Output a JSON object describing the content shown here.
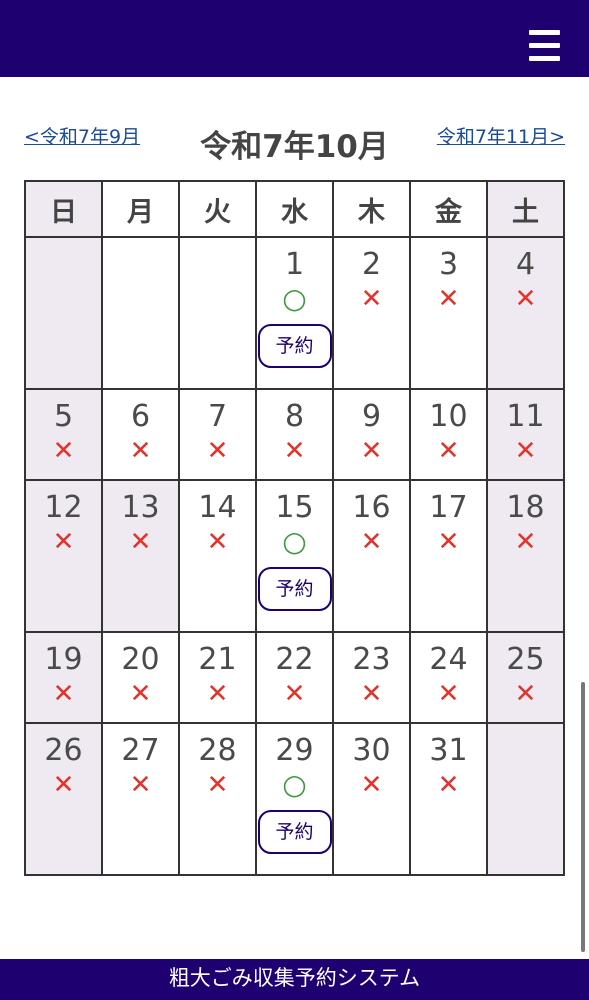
{
  "header": {
    "menu_icon": "hamburger-menu-icon",
    "color": "#1e0070"
  },
  "nav": {
    "prev_label": "<令和7年9月",
    "title": "令和7年10月",
    "next_label": "令和7年11月>"
  },
  "weekdays": [
    "日",
    "月",
    "火",
    "水",
    "木",
    "金",
    "土"
  ],
  "calendar": {
    "rows": [
      [
        {
          "day": "",
          "mark": "",
          "reserve": false,
          "holiday": true
        },
        {
          "day": "",
          "mark": "",
          "reserve": false,
          "holiday": false
        },
        {
          "day": "",
          "mark": "",
          "reserve": false,
          "holiday": false
        },
        {
          "day": "1",
          "mark": "○",
          "reserve": true,
          "holiday": false
        },
        {
          "day": "2",
          "mark": "✕",
          "reserve": false,
          "holiday": false
        },
        {
          "day": "3",
          "mark": "✕",
          "reserve": false,
          "holiday": false
        },
        {
          "day": "4",
          "mark": "✕",
          "reserve": false,
          "holiday": true
        }
      ],
      [
        {
          "day": "5",
          "mark": "✕",
          "reserve": false,
          "holiday": true
        },
        {
          "day": "6",
          "mark": "✕",
          "reserve": false,
          "holiday": false
        },
        {
          "day": "7",
          "mark": "✕",
          "reserve": false,
          "holiday": false
        },
        {
          "day": "8",
          "mark": "✕",
          "reserve": false,
          "holiday": false
        },
        {
          "day": "9",
          "mark": "✕",
          "reserve": false,
          "holiday": false
        },
        {
          "day": "10",
          "mark": "✕",
          "reserve": false,
          "holiday": false
        },
        {
          "day": "11",
          "mark": "✕",
          "reserve": false,
          "holiday": true
        }
      ],
      [
        {
          "day": "12",
          "mark": "✕",
          "reserve": false,
          "holiday": true
        },
        {
          "day": "13",
          "mark": "✕",
          "reserve": false,
          "holiday": true
        },
        {
          "day": "14",
          "mark": "✕",
          "reserve": false,
          "holiday": false
        },
        {
          "day": "15",
          "mark": "○",
          "reserve": true,
          "holiday": false
        },
        {
          "day": "16",
          "mark": "✕",
          "reserve": false,
          "holiday": false
        },
        {
          "day": "17",
          "mark": "✕",
          "reserve": false,
          "holiday": false
        },
        {
          "day": "18",
          "mark": "✕",
          "reserve": false,
          "holiday": true
        }
      ],
      [
        {
          "day": "19",
          "mark": "✕",
          "reserve": false,
          "holiday": true
        },
        {
          "day": "20",
          "mark": "✕",
          "reserve": false,
          "holiday": false
        },
        {
          "day": "21",
          "mark": "✕",
          "reserve": false,
          "holiday": false
        },
        {
          "day": "22",
          "mark": "✕",
          "reserve": false,
          "holiday": false
        },
        {
          "day": "23",
          "mark": "✕",
          "reserve": false,
          "holiday": false
        },
        {
          "day": "24",
          "mark": "✕",
          "reserve": false,
          "holiday": false
        },
        {
          "day": "25",
          "mark": "✕",
          "reserve": false,
          "holiday": true
        }
      ],
      [
        {
          "day": "26",
          "mark": "✕",
          "reserve": false,
          "holiday": true
        },
        {
          "day": "27",
          "mark": "✕",
          "reserve": false,
          "holiday": false
        },
        {
          "day": "28",
          "mark": "✕",
          "reserve": false,
          "holiday": false
        },
        {
          "day": "29",
          "mark": "○",
          "reserve": true,
          "holiday": false
        },
        {
          "day": "30",
          "mark": "✕",
          "reserve": false,
          "holiday": false
        },
        {
          "day": "31",
          "mark": "✕",
          "reserve": false,
          "holiday": false
        },
        {
          "day": "",
          "mark": "",
          "reserve": false,
          "holiday": true
        }
      ]
    ],
    "reserve_label": "予約"
  },
  "colors": {
    "brand": "#1e0070",
    "holiday_bg": "#efe9f1",
    "unavailable": "#e0342c",
    "available": "#3b9a3b",
    "link": "#1a4a9a"
  },
  "footer": {
    "title": "粗大ごみ収集予約システム"
  }
}
